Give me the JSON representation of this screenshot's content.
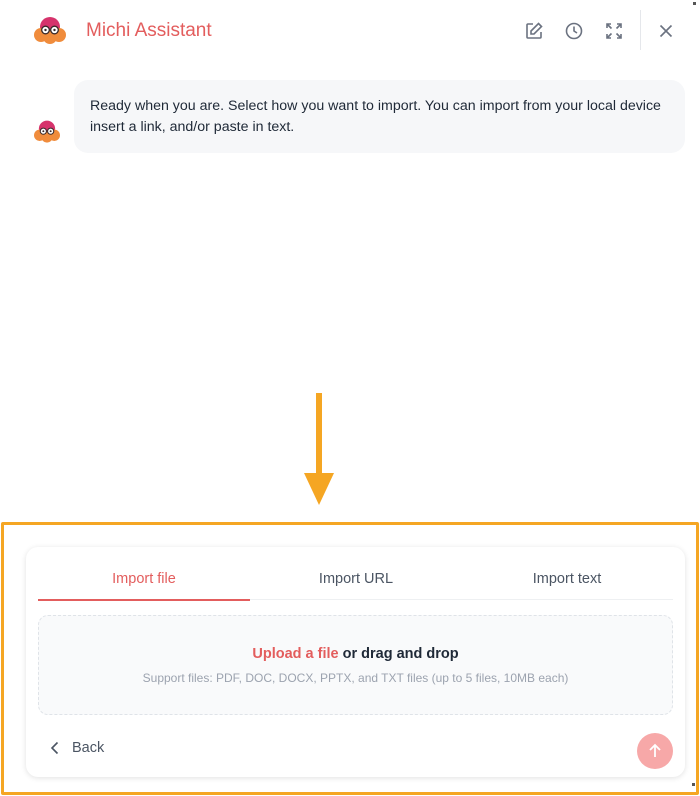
{
  "header": {
    "title": "Michi Assistant",
    "actions": [
      "edit-icon",
      "history-icon",
      "expand-icon",
      "close-icon"
    ]
  },
  "messages": [
    {
      "sender": "assistant",
      "text": "Ready when you are. Select how you want to import. You can import from your local device insert a link, and/or paste in text."
    }
  ],
  "import_panel": {
    "tabs": [
      {
        "label": "Import file",
        "active": true
      },
      {
        "label": "Import URL",
        "active": false
      },
      {
        "label": "Import text",
        "active": false
      }
    ],
    "dropzone": {
      "link_text": "Upload a file",
      "rest_text": " or drag and drop",
      "support_text": "Support files: PDF, DOC, DOCX, PPTX, and TXT files (up to 5 files, 10MB each)"
    },
    "back_label": "Back"
  },
  "colors": {
    "accent": "#e35d5d",
    "annotation": "#f5a623",
    "send_button": "#f7a8a8"
  }
}
